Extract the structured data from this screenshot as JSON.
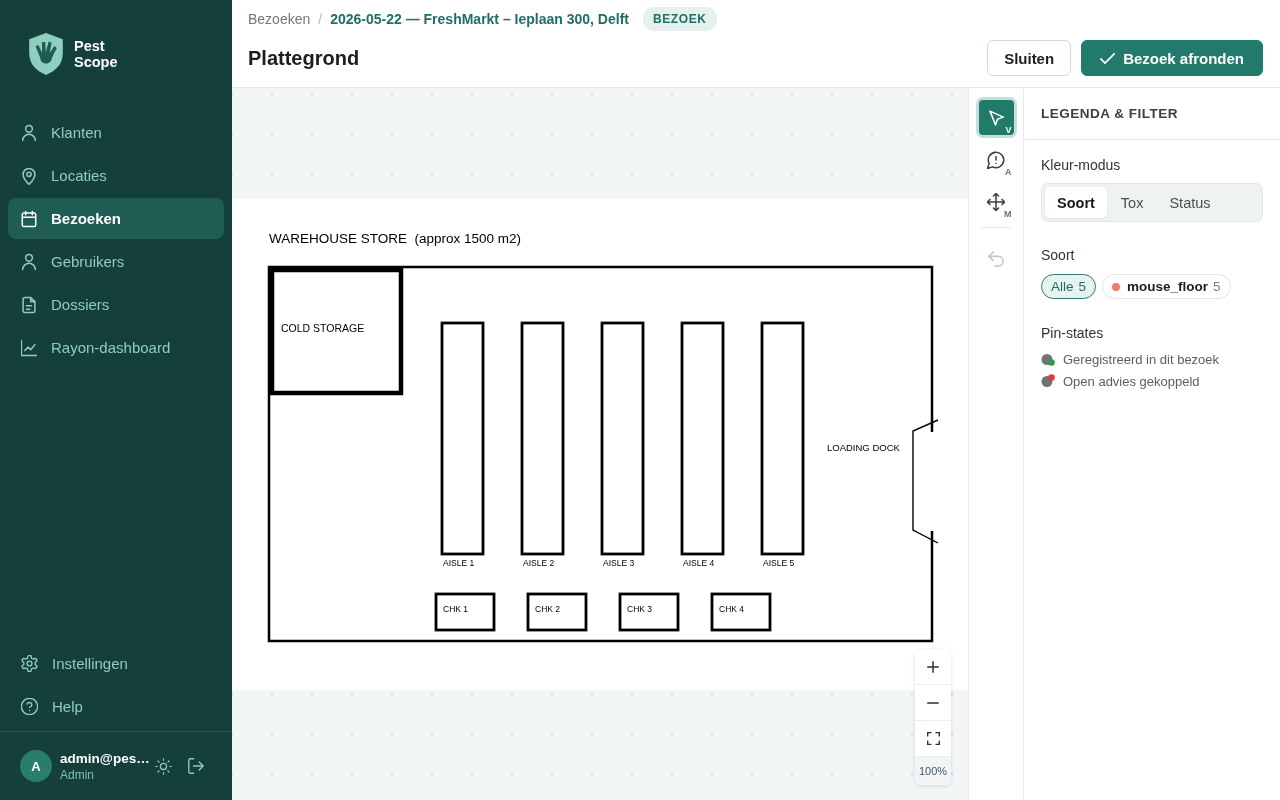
{
  "sidebar": {
    "logo_text": "Pest Scope",
    "nav": [
      {
        "label": "Klanten",
        "selected": false
      },
      {
        "label": "Locaties",
        "selected": false
      },
      {
        "label": "Bezoeken",
        "selected": true
      },
      {
        "label": "Gebruikers",
        "selected": false
      },
      {
        "label": "Dossiers",
        "selected": false
      },
      {
        "label": "Rayon-dashboard",
        "selected": false
      }
    ],
    "footer_nav": [
      {
        "label": "Instellingen",
        "selected": false
      },
      {
        "label": "Help",
        "selected": false
      }
    ],
    "user": {
      "initial": "A",
      "name": "admin@pes…",
      "role": "Admin"
    }
  },
  "header": {
    "breadcrumb": {
      "parent": "Bezoeken",
      "separator": "/",
      "current": "2026-05-22 — FreshMarkt – Ieplaan 300, Delft",
      "badge": "BEZOEK"
    },
    "title": "Plattegrond",
    "buttons": [
      {
        "label": "Sluiten",
        "kind": "secondary"
      },
      {
        "label": "Bezoek afronden",
        "kind": "primary"
      }
    ]
  },
  "floor_plan": {
    "title": "WAREHOUSE STORE  (approx 1500 m2)",
    "cold_storage": "COLD STORAGE",
    "aisles": [
      "AISLE 1",
      "AISLE 2",
      "AISLE 3",
      "AISLE 4",
      "AISLE 5"
    ],
    "checkouts": [
      "CHK 1",
      "CHK 2",
      "CHK 3",
      "CHK 4"
    ],
    "loading_dock": "LOADING DOCK"
  },
  "zoom_controls": {
    "level_label": "100%"
  },
  "tools": [
    {
      "shortcut": "V",
      "selected": true
    },
    {
      "shortcut": "A",
      "selected": false
    },
    {
      "shortcut": "M",
      "selected": false
    }
  ],
  "undo": {
    "disabled": true
  },
  "legend": {
    "title": "LEGENDA & FILTER",
    "color_mode": {
      "label": "Kleur-modus",
      "options": [
        {
          "label": "Soort",
          "selected": true
        },
        {
          "label": "Tox",
          "selected": false
        },
        {
          "label": "Status",
          "selected": false
        }
      ]
    },
    "species_filter": {
      "label": "Soort",
      "chips": [
        {
          "label": "Alle",
          "count": "5",
          "selected": true
        },
        {
          "label": "mouse_floor",
          "count": "5",
          "selected": false,
          "color": "#f07b6c"
        }
      ]
    },
    "pin_states": {
      "label": "Pin-states",
      "items": [
        {
          "label": "Geregistreerd in dit bezoek",
          "kind": "registered",
          "color": "#2e9b47"
        },
        {
          "label": "Open advies gekoppeld",
          "kind": "advice",
          "color": "#e0393e"
        }
      ]
    }
  }
}
